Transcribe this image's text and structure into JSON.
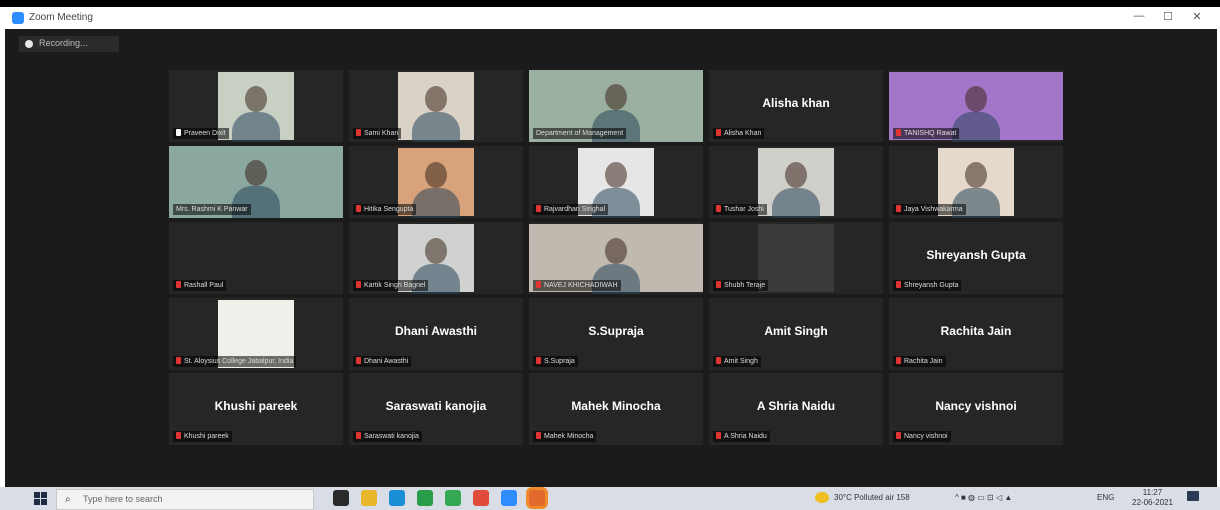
{
  "window": {
    "title": "Zoom Meeting",
    "minimize": "—",
    "maximize": "☐",
    "close": "✕"
  },
  "recording": {
    "label": "Recording..."
  },
  "tiles": [
    {
      "label": "Praveen Dixit",
      "big_name": "",
      "video": "#c8d0c4",
      "mic": "host",
      "active": false
    },
    {
      "label": "Sami Khan",
      "big_name": "",
      "video": "#d9d2c6",
      "mic": "muted",
      "active": false
    },
    {
      "label": "Department of Management",
      "big_name": "",
      "video": "#9bb0a0",
      "mic": "none",
      "active": true
    },
    {
      "label": "Alisha Khan",
      "big_name": "Alisha khan",
      "video": "",
      "mic": "muted",
      "active": false
    },
    {
      "label": "TANISHQ Rawat",
      "big_name": "",
      "video": "#a476c9",
      "mic": "muted",
      "active": false
    },
    {
      "label": "Mrs. Rashmi K Panwar",
      "big_name": "",
      "video": "#8aa7a0",
      "mic": "none",
      "active": false
    },
    {
      "label": "Hitika Sengupta",
      "big_name": "",
      "video": "#d8a27a",
      "mic": "muted",
      "active": false
    },
    {
      "label": "Rajvardhan Singhal",
      "big_name": "",
      "video": "#e6e6e6",
      "mic": "muted",
      "active": false
    },
    {
      "label": "Tushar Joshi",
      "big_name": "",
      "video": "#d0cfca",
      "mic": "muted",
      "active": false
    },
    {
      "label": "Jaya Vishwakarma",
      "big_name": "",
      "video": "#e4d9cc",
      "mic": "muted",
      "active": false
    },
    {
      "label": "Rashall Paul",
      "big_name": "",
      "video": "",
      "mic": "muted",
      "active": false
    },
    {
      "label": "Kartik Singh Bagnel",
      "big_name": "",
      "video": "#cfd2cf",
      "mic": "muted",
      "active": false
    },
    {
      "label": "NAVEJ KHICHADIWAH",
      "big_name": "",
      "video": "#bfb9b0",
      "mic": "muted",
      "active": false
    },
    {
      "label": "Shubh Teraje",
      "big_name": "",
      "video": "#3a3a3a",
      "mic": "muted",
      "active": false
    },
    {
      "label": "Shreyansh Gupta",
      "big_name": "Shreyansh Gupta",
      "video": "",
      "mic": "muted",
      "active": false
    },
    {
      "label": "St. Aloysius College Jabalpur, India",
      "big_name": "",
      "video": "#f1efe9",
      "mic": "muted",
      "active": false
    },
    {
      "label": "Dhani Awasthi",
      "big_name": "Dhani Awasthi",
      "video": "",
      "mic": "muted",
      "active": false
    },
    {
      "label": "S.Supraja",
      "big_name": "S.Supraja",
      "video": "",
      "mic": "muted",
      "active": false
    },
    {
      "label": "Amit Singh",
      "big_name": "Amit Singh",
      "video": "",
      "mic": "muted",
      "active": false
    },
    {
      "label": "Rachita Jain",
      "big_name": "Rachita Jain",
      "video": "",
      "mic": "muted",
      "active": false
    },
    {
      "label": "Khushi pareek",
      "big_name": "Khushi pareek",
      "video": "",
      "mic": "muted",
      "active": false
    },
    {
      "label": "Saraswati kanojia",
      "big_name": "Saraswati kanojia",
      "video": "",
      "mic": "muted",
      "active": false
    },
    {
      "label": "Mahek Minocha",
      "big_name": "Mahek Minocha",
      "video": "",
      "mic": "muted",
      "active": false
    },
    {
      "label": "A Shria Naidu",
      "big_name": "A Shria Naidu",
      "video": "",
      "mic": "muted",
      "active": false
    },
    {
      "label": "Nancy vishnoi",
      "big_name": "Nancy vishnoi",
      "video": "",
      "mic": "muted",
      "active": false
    }
  ],
  "taskbar": {
    "search_placeholder": "Type here to search",
    "apps": [
      {
        "name": "task-view-icon",
        "color": "#2a2a2a"
      },
      {
        "name": "file-explorer-icon",
        "color": "#e8b72a"
      },
      {
        "name": "edge-browser-icon",
        "color": "#1b8fd6"
      },
      {
        "name": "store-icon",
        "color": "#2a9d4a"
      },
      {
        "name": "chrome-icon",
        "color": "#34a853"
      },
      {
        "name": "chrome-profile-icon",
        "color": "#e14b3b"
      },
      {
        "name": "zoom-app-icon",
        "color": "#2d8cff"
      },
      {
        "name": "powerpoint-icon",
        "color": "#e26a2c"
      }
    ],
    "weather": "30°C Polluted air 158",
    "lang": "ENG",
    "time": "11:27",
    "date": "22-06-2021"
  }
}
